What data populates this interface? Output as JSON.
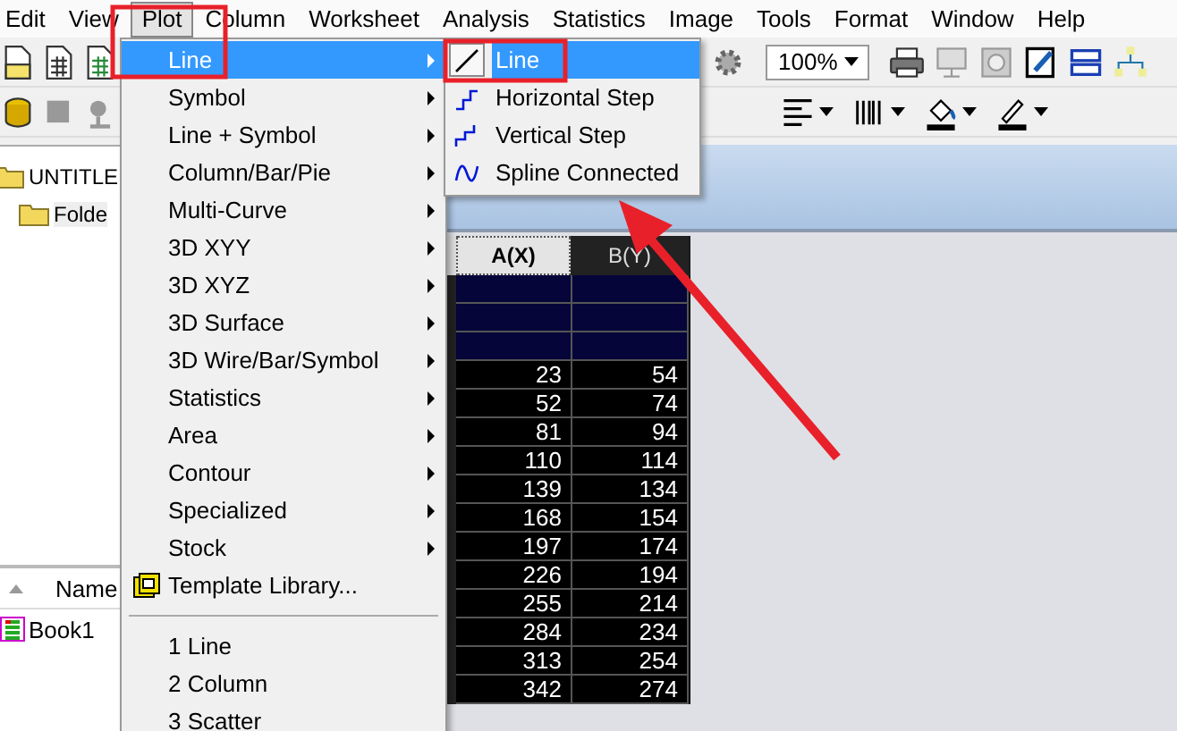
{
  "menu_bar": [
    {
      "label": "Edit",
      "selected": false
    },
    {
      "label": "View",
      "selected": false
    },
    {
      "label": "Plot",
      "selected": true
    },
    {
      "label": "Column",
      "selected": false
    },
    {
      "label": "Worksheet",
      "selected": false
    },
    {
      "label": "Analysis",
      "selected": false
    },
    {
      "label": "Statistics",
      "selected": false
    },
    {
      "label": "Image",
      "selected": false
    },
    {
      "label": "Tools",
      "selected": false
    },
    {
      "label": "Format",
      "selected": false
    },
    {
      "label": "Window",
      "selected": false
    },
    {
      "label": "Help",
      "selected": false
    }
  ],
  "toolbar": {
    "zoom": "100%"
  },
  "explorer": {
    "tree": [
      {
        "label": "UNTITLE",
        "children": [
          {
            "label": "Folde"
          }
        ]
      }
    ],
    "list_header": "Name",
    "items": [
      "Book1"
    ]
  },
  "worksheet": {
    "columns": [
      "A(X)",
      "B(Y)"
    ],
    "rows": [
      [
        "23",
        "54"
      ],
      [
        "52",
        "74"
      ],
      [
        "81",
        "94"
      ],
      [
        "110",
        "114"
      ],
      [
        "139",
        "134"
      ],
      [
        "168",
        "154"
      ],
      [
        "197",
        "174"
      ],
      [
        "226",
        "194"
      ],
      [
        "255",
        "214"
      ],
      [
        "284",
        "234"
      ],
      [
        "313",
        "254"
      ],
      [
        "342",
        "274"
      ]
    ]
  },
  "plot_menu": {
    "items": [
      {
        "kind": "submenu",
        "label": "Line",
        "selected": true
      },
      {
        "kind": "submenu",
        "label": "Symbol",
        "selected": false
      },
      {
        "kind": "submenu",
        "label": "Line + Symbol",
        "selected": false
      },
      {
        "kind": "submenu",
        "label": "Column/Bar/Pie",
        "selected": false
      },
      {
        "kind": "submenu",
        "label": "Multi-Curve",
        "selected": false
      },
      {
        "kind": "submenu",
        "label": "3D XYY",
        "selected": false
      },
      {
        "kind": "submenu",
        "label": "3D XYZ",
        "selected": false
      },
      {
        "kind": "submenu",
        "label": "3D Surface",
        "selected": false
      },
      {
        "kind": "submenu",
        "label": "3D Wire/Bar/Symbol",
        "selected": false
      },
      {
        "kind": "submenu",
        "label": "Statistics",
        "selected": false
      },
      {
        "kind": "submenu",
        "label": "Area",
        "selected": false
      },
      {
        "kind": "submenu",
        "label": "Contour",
        "selected": false
      },
      {
        "kind": "submenu",
        "label": "Specialized",
        "selected": false
      },
      {
        "kind": "submenu",
        "label": "Stock",
        "selected": false
      },
      {
        "kind": "template",
        "label": "Template Library...",
        "selected": false
      },
      {
        "kind": "separator"
      },
      {
        "kind": "item",
        "label": "1 Line",
        "selected": false
      },
      {
        "kind": "item",
        "label": "2 Column",
        "selected": false
      },
      {
        "kind": "item",
        "label": "3 Scatter",
        "selected": false
      }
    ]
  },
  "line_submenu": {
    "items": [
      {
        "kind": "line",
        "label": "Line",
        "selected": true
      },
      {
        "kind": "hstep",
        "label": "Horizontal Step",
        "selected": false
      },
      {
        "kind": "vstep",
        "label": "Vertical Step",
        "selected": false
      },
      {
        "kind": "spline",
        "label": "Spline Connected",
        "selected": false
      }
    ]
  }
}
